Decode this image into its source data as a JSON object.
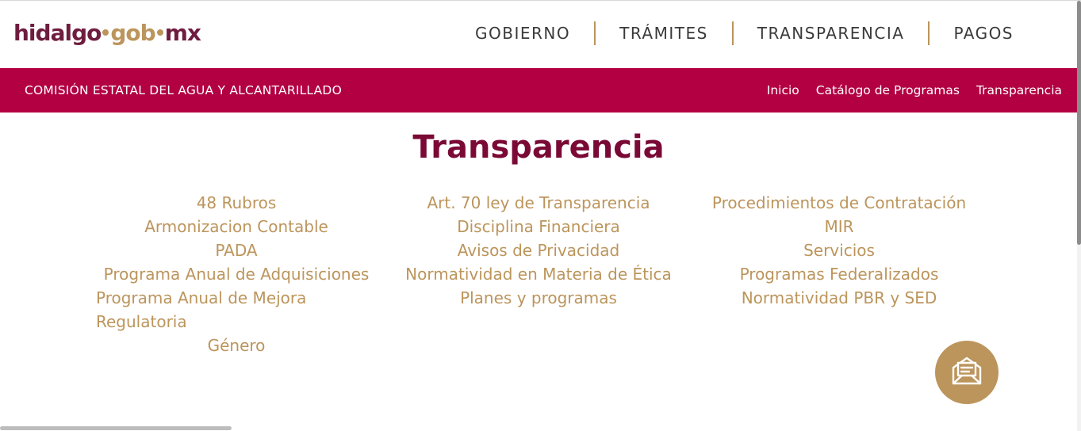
{
  "header": {
    "logo": {
      "part1": "hidalgo",
      "part2": "gob",
      "part3": "mx"
    },
    "nav": [
      "GOBIERNO",
      "TRÁMITES",
      "TRANSPARENCIA",
      "PAGOS"
    ]
  },
  "subnav": {
    "org_name": "COMISIÓN ESTATAL DEL AGUA Y ALCANTARILLADO",
    "links": [
      "Inicio",
      "Catálogo de Programas",
      "Transparencia"
    ]
  },
  "page": {
    "title": "Transparencia",
    "col1": [
      "48 Rubros",
      "Armonizacion Contable",
      "PADA",
      "Programa Anual de Adquisiciones",
      "Programa Anual de Mejora Regulatoria",
      "Género"
    ],
    "col2": [
      "Art. 70 ley de Transparencia",
      "Disciplina Financiera",
      "Avisos de Privacidad",
      "Normatividad en Materia de Ética",
      "Planes y programas"
    ],
    "col3": [
      "Procedimientos de Contratación",
      "MIR",
      "Servicios",
      "Programas Federalizados",
      "Normatividad PBR y SED"
    ]
  },
  "colors": {
    "brand_wine": "#6f1d3f",
    "brand_gold": "#bc955c",
    "bar_red": "#b20042"
  },
  "icons": {
    "fab": "mail-envelope-icon"
  }
}
